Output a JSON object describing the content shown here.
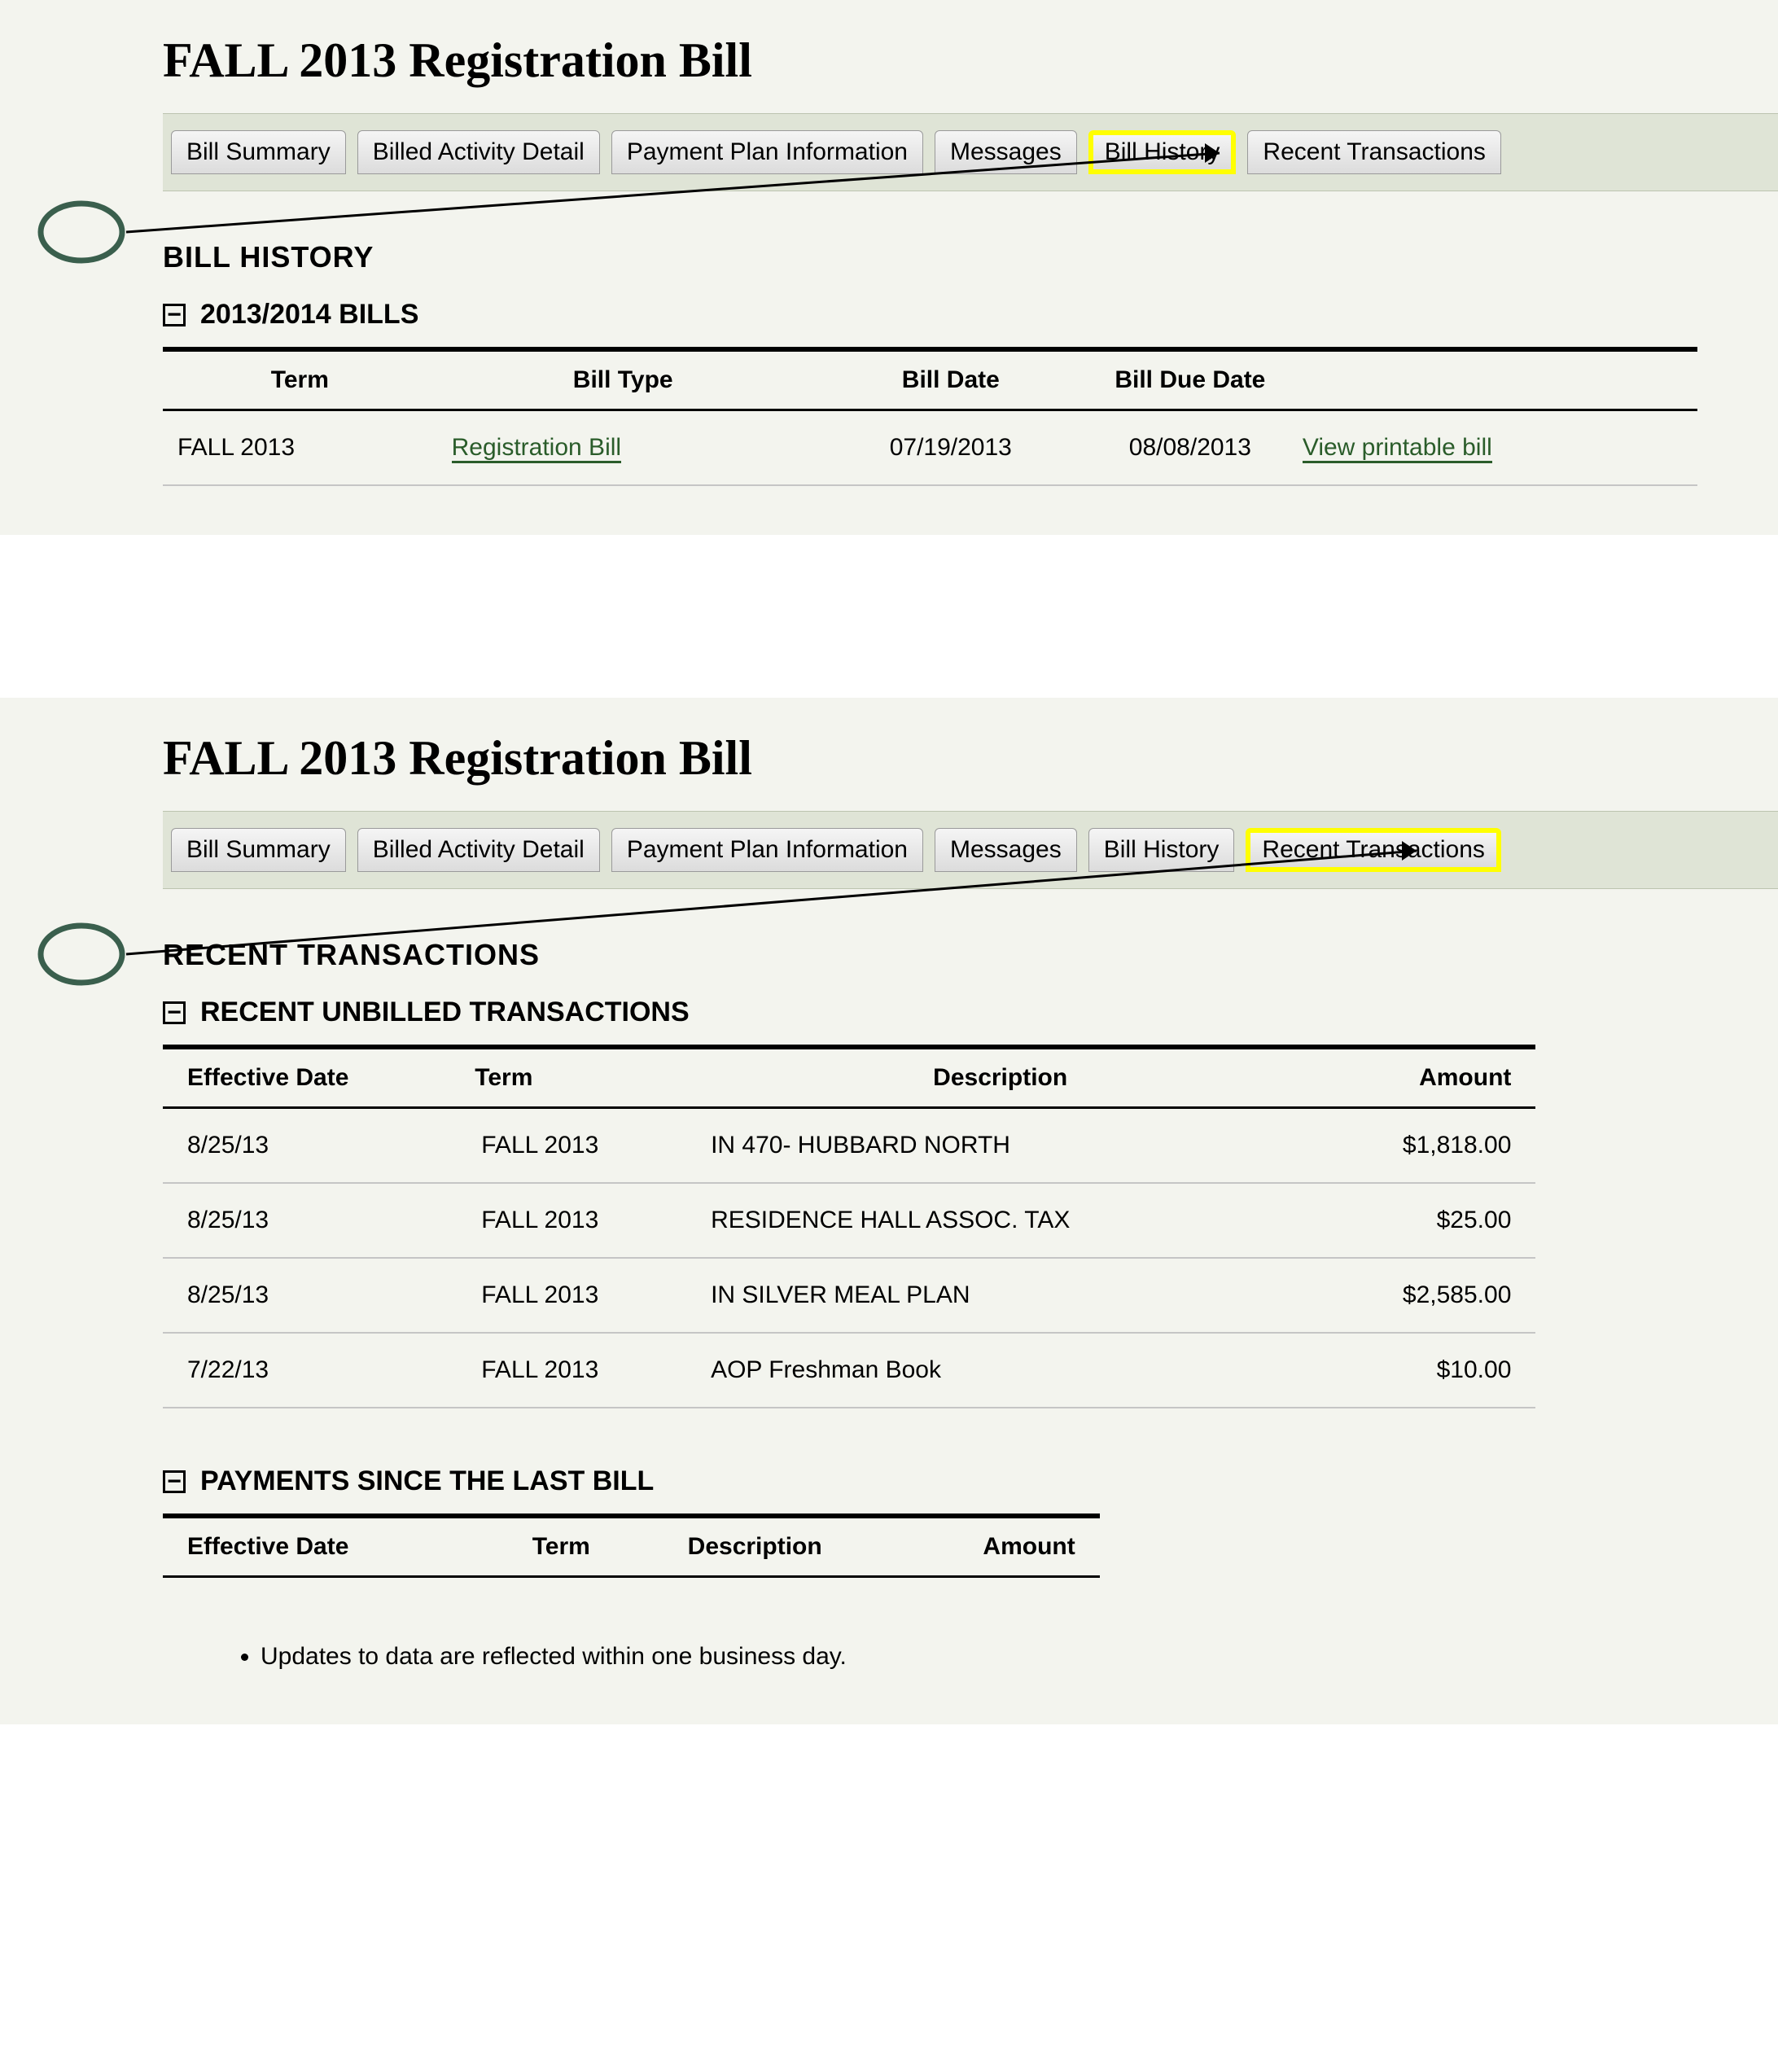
{
  "page_title": "FALL 2013 Registration Bill",
  "tabs": [
    {
      "label": "Bill Summary"
    },
    {
      "label": "Billed Activity Detail"
    },
    {
      "label": "Payment Plan Information"
    },
    {
      "label": "Messages"
    },
    {
      "label": "Bill History"
    },
    {
      "label": "Recent Transactions"
    }
  ],
  "bill_history": {
    "heading": "BILL HISTORY",
    "group_label": "2013/2014 BILLS",
    "columns": [
      "Term",
      "Bill Type",
      "Bill Date",
      "Bill Due Date",
      ""
    ],
    "rows": [
      {
        "term": "FALL 2013",
        "bill_type": "Registration Bill",
        "bill_date": "07/19/2013",
        "due_date": "08/08/2013",
        "action": "View printable bill"
      }
    ]
  },
  "recent_tx": {
    "heading": "RECENT TRANSACTIONS",
    "unbilled_label": "RECENT UNBILLED TRANSACTIONS",
    "unbilled_columns": [
      "Effective Date",
      "Term",
      "Description",
      "Amount"
    ],
    "unbilled_rows": [
      {
        "date": "8/25/13",
        "term": "FALL 2013",
        "desc": "IN 470- HUBBARD NORTH",
        "amount": "$1,818.00"
      },
      {
        "date": "8/25/13",
        "term": "FALL 2013",
        "desc": "RESIDENCE HALL ASSOC. TAX",
        "amount": "$25.00"
      },
      {
        "date": "8/25/13",
        "term": "FALL 2013",
        "desc": "IN SILVER MEAL PLAN",
        "amount": "$2,585.00"
      },
      {
        "date": "7/22/13",
        "term": "FALL 2013",
        "desc": "AOP Freshman Book",
        "amount": "$10.00"
      }
    ],
    "payments_label": "PAYMENTS SINCE THE LAST BILL",
    "payments_columns": [
      "Effective Date",
      "Term",
      "Description",
      "Amount"
    ],
    "payments_rows": []
  },
  "notes": [
    "Updates to data are reflected within one business day."
  ],
  "collapse_glyph": "−"
}
